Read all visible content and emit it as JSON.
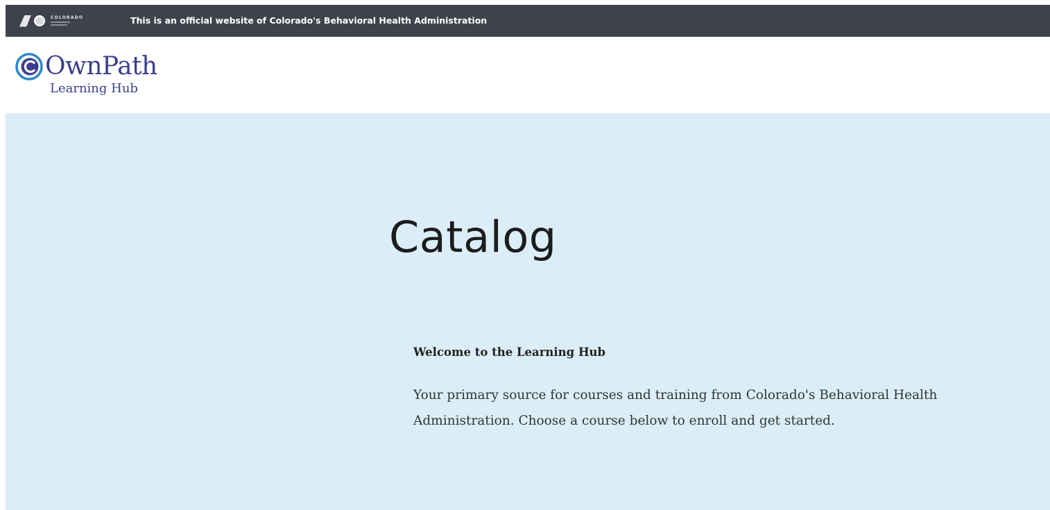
{
  "gov_bar": {
    "logo_icon": "colorado-state-logo",
    "logo_text": "COLORADO",
    "notice": "This is an official website of Colorado's Behavioral Health Administration",
    "background_color": "#3e434b"
  },
  "header": {
    "logo_icon": "ownpath-c-logo-icon",
    "brand_name": "OwnPath",
    "brand_subtitle": "Learning Hub",
    "brand_color": "#3c3f8f",
    "accent_color": "#2b88c8"
  },
  "hero": {
    "title": "Catalog",
    "welcome_heading": "Welcome to the Learning Hub",
    "welcome_body": "Your primary source for courses and training from Colorado's Behavioral Health Administration. Choose a course below to enroll and get started.",
    "background_color": "#dbeef8"
  }
}
